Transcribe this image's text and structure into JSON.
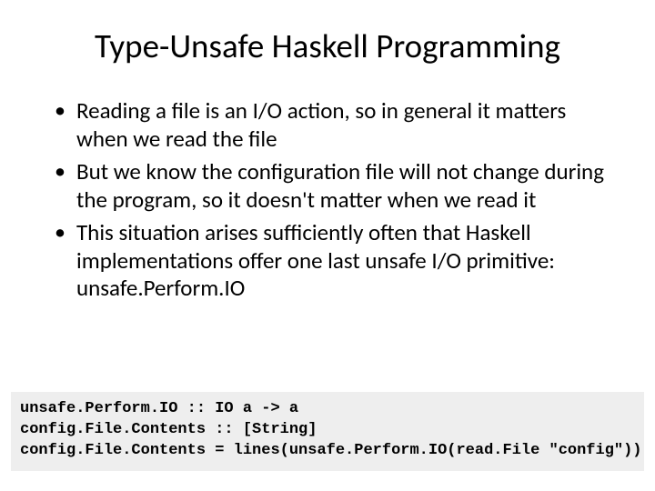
{
  "title": "Type-Unsafe Haskell Programming",
  "bullets": [
    "Reading a file is an I/O action, so in general it matters when we read the file",
    "But we know the configuration file will not change during the program, so it doesn't matter when we read it",
    "This situation arises sufficiently often that Haskell implementations offer one last unsafe I/O primitive: unsafe.Perform.IO"
  ],
  "code": {
    "line1": "unsafe.Perform.IO :: IO a -> a",
    "line2": "config.File.Contents :: [String]",
    "line3": "config.File.Contents = lines(unsafe.Perform.IO(read.File \"config\"))"
  }
}
